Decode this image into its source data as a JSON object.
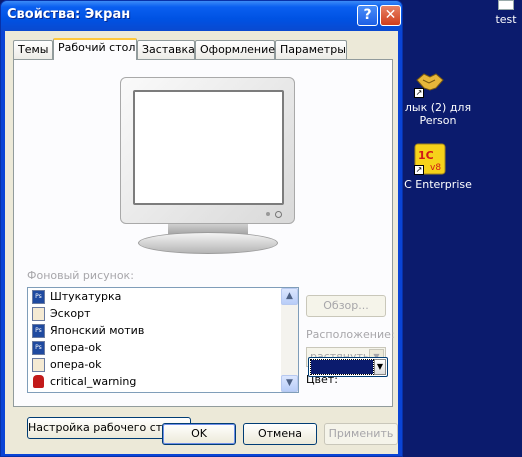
{
  "window": {
    "title": "Свойства: Экран",
    "help_button": "?",
    "close_button": "✕"
  },
  "tabs": [
    {
      "label": "Темы",
      "active": false
    },
    {
      "label": "Рабочий стол",
      "active": true
    },
    {
      "label": "Заставка",
      "active": false
    },
    {
      "label": "Оформление",
      "active": false
    },
    {
      "label": "Параметры",
      "active": false
    }
  ],
  "desktop_page": {
    "background_label": "Фоновый рисунок:",
    "backgrounds": [
      {
        "name": "Штукатурка",
        "icon": "photoshop-file-icon"
      },
      {
        "name": "Эскорт",
        "icon": "image-file-icon"
      },
      {
        "name": "Японский мотив",
        "icon": "photoshop-file-icon"
      },
      {
        "name": "опера-ok",
        "icon": "photoshop-file-icon"
      },
      {
        "name": "опера-ok",
        "icon": "image-file-icon"
      },
      {
        "name": "critical_warning",
        "icon": "warning-file-icon"
      }
    ],
    "browse_button": "Обзор...",
    "position_label": "Расположение:",
    "position_value": "растянуть",
    "color_label": "Цвет:",
    "color_value": "#0b1b6d",
    "customize_button": "Настройка рабочего стола..."
  },
  "footer": {
    "ok": "OK",
    "cancel": "Отмена",
    "apply": "Применить"
  },
  "desktop_icons": [
    {
      "label": "test"
    },
    {
      "label_line1": "лык (2) для",
      "label_line2": "Person"
    },
    {
      "label": "C Enterprise",
      "icon_text": "1C v8"
    }
  ]
}
